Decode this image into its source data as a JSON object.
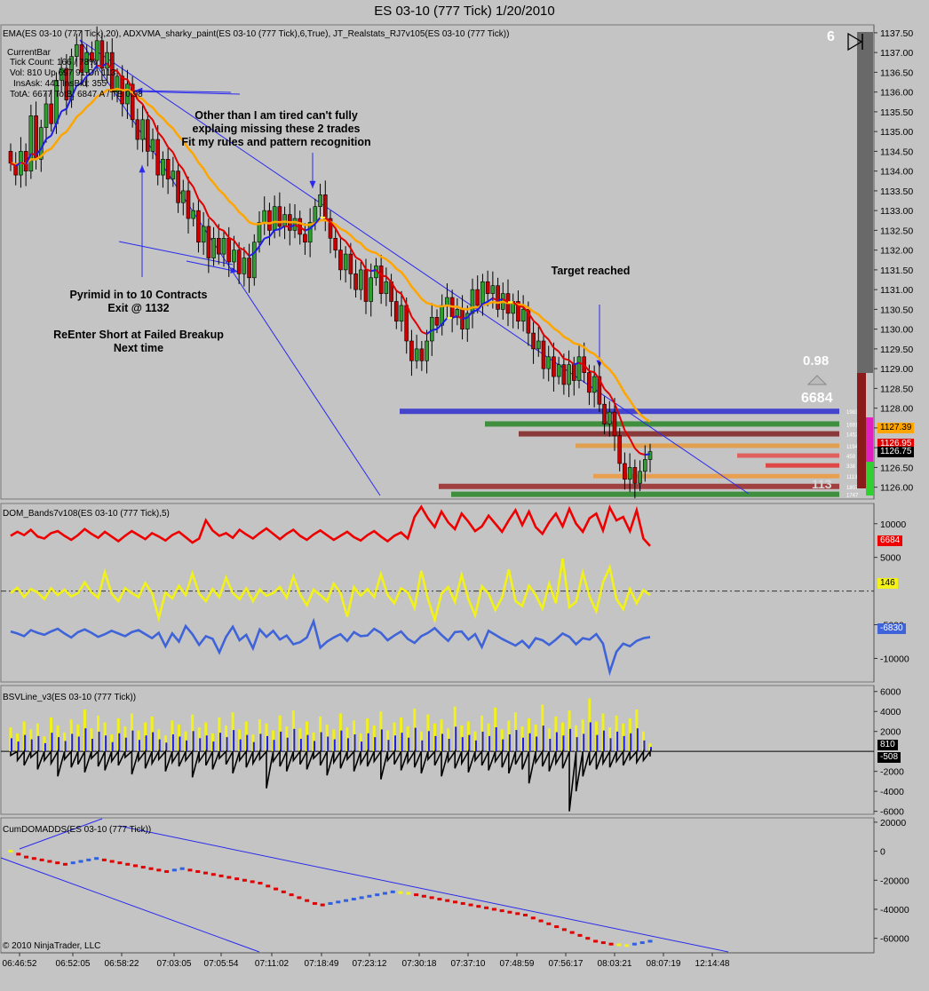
{
  "window_title": "ES 03-10 (777 Tick)  1/20/2010",
  "copyright": "© 2010 NinjaTrader, LLC",
  "panels": {
    "price_label": "EMA(ES 03-10 (777 Tick),20), ADXVMA_sharky_paint(ES 03-10 (777 Tick),6,True), JT_Realstats_RJ7v105(ES 03-10 (777 Tick))",
    "dom_label": "DOM_Bands7v108(ES 03-10 (777 Tick),5)",
    "bsv_label": "BSVLine_v3(ES 03-10 (777 Tick))",
    "cum_label": "CumDOMADDS(ES 03-10 (777 Tick))"
  },
  "current_bar": {
    "title": "CurrentBar",
    "line1": "Tick Count: 166  /  78%",
    "line2": "Vol: 810   Up 697  91   Dn 113",
    "line3": "InsAsk: 441   InsBid: 355",
    "line4": "TotA: 6677  TotB: 6847  A / TB 0.98"
  },
  "annotations": {
    "tired_1": "Other than I am tired can't fully",
    "tired_2": "explaing missing these 2 trades",
    "tired_3": "Fit my rules and pattern recognition",
    "pyramid_1": "Pyrimid in to 10 Contracts",
    "pyramid_2": "Exit @ 1132",
    "reenter_1": "ReEnter Short at Failed Breakup",
    "reenter_2": "Next time",
    "target": "Target reached"
  },
  "stats": {
    "count": "6",
    "ratio": "0.98",
    "total": "6684",
    "small": "113"
  },
  "tags": {
    "price_a": "1127.39",
    "price_b": "1126.95",
    "price_c": "1126.75",
    "dom_red": "6684",
    "dom_yellow": "146",
    "dom_blue": "-6830",
    "bsv_a": "810",
    "bsv_b": "-508"
  },
  "level_labels": [
    "1983",
    "1691",
    "1452",
    "1194",
    "459",
    "338",
    "1113",
    "1807",
    "1747"
  ],
  "colors": {
    "bg": "#c4c4c4",
    "up": "#2e9e2e",
    "down": "#c80000",
    "ema": "#ffa500",
    "adx_red": "#e00000",
    "adx_blue": "#1e1ee6",
    "adx_yellow": "#ffff33",
    "trend": "#2a2aee",
    "dom_red": "#ee0000",
    "dom_yellow": "#f2f21a",
    "dom_blue": "#3f63d8"
  },
  "chart_data": [
    {
      "type": "candlestick",
      "name": "price",
      "ylim": [
        1125.7,
        1137.7
      ],
      "y_ticks": [
        "1137.50",
        "1137.00",
        "1136.50",
        "1136.00",
        "1135.50",
        "1135.00",
        "1134.50",
        "1134.00",
        "1133.50",
        "1133.00",
        "1132.50",
        "1132.00",
        "1131.50",
        "1131.00",
        "1130.50",
        "1130.00",
        "1129.50",
        "1129.00",
        "1128.50",
        "1128.00",
        "1127.50",
        "1127.00",
        "1126.50",
        "1126.00"
      ],
      "closes": [
        1134.2,
        1133.9,
        1134.5,
        1134.0,
        1135.4,
        1134.3,
        1135.1,
        1135.7,
        1135.2,
        1136.3,
        1136.6,
        1135.8,
        1136.9,
        1137.2,
        1136.5,
        1137.0,
        1136.8,
        1137.3,
        1136.6,
        1137.0,
        1136.0,
        1136.4,
        1135.7,
        1136.2,
        1135.3,
        1134.8,
        1135.3,
        1134.5,
        1134.8,
        1133.9,
        1134.3,
        1133.8,
        1134.0,
        1133.2,
        1133.5,
        1132.8,
        1133.0,
        1132.2,
        1132.6,
        1131.8,
        1132.3,
        1131.9,
        1132.3,
        1131.7,
        1132.0,
        1131.4,
        1131.8,
        1131.3,
        1132.2,
        1132.7,
        1133.0,
        1132.5,
        1133.1,
        1132.6,
        1132.9,
        1132.5,
        1132.8,
        1132.4,
        1132.2,
        1132.7,
        1133.1,
        1133.4,
        1132.8,
        1132.3,
        1132.0,
        1131.5,
        1131.9,
        1131.4,
        1131.0,
        1131.5,
        1130.7,
        1131.3,
        1131.6,
        1130.9,
        1131.2,
        1130.7,
        1130.2,
        1130.6,
        1129.7,
        1129.2,
        1129.5,
        1129.2,
        1129.7,
        1130.3,
        1130.1,
        1130.6,
        1130.8,
        1130.3,
        1130.5,
        1130.0,
        1130.4,
        1131.0,
        1130.6,
        1131.2,
        1130.9,
        1131.1,
        1130.5,
        1130.9,
        1130.4,
        1130.7,
        1130.2,
        1130.5,
        1129.9,
        1129.5,
        1129.7,
        1129.0,
        1129.3,
        1128.8,
        1129.1,
        1128.6,
        1129.1,
        1128.7,
        1129.3,
        1128.9,
        1128.4,
        1128.8,
        1128.1,
        1127.6,
        1127.9,
        1127.3,
        1126.6,
        1126.2,
        1126.5,
        1126.1,
        1126.4,
        1126.7,
        1126.9
      ]
    },
    {
      "type": "line",
      "name": "DOM_Bands",
      "ylim": [
        -13500,
        13000
      ],
      "y_ticks": [
        "10000",
        "5000",
        "-5000",
        "-10000"
      ],
      "series": [
        {
          "name": "red",
          "values": [
            8200,
            8800,
            8300,
            9100,
            8100,
            7800,
            8600,
            8900,
            8200,
            7600,
            8300,
            9200,
            8500,
            7900,
            8800,
            8100,
            7400,
            8200,
            8900,
            8300,
            7700,
            8600,
            8100,
            7500,
            8300,
            8800,
            8000,
            7200,
            7800,
            10500,
            9000,
            8200,
            8600,
            7900,
            9100,
            8400,
            7800,
            8600,
            9300,
            8500,
            7700,
            8500,
            9100,
            8200,
            7600,
            8400,
            9000,
            8300,
            7600,
            8200,
            8800,
            8000,
            7500,
            8300,
            8900,
            8100,
            7400,
            8200,
            8700,
            7800,
            11000,
            12500,
            10800,
            9500,
            11800,
            10200,
            9200,
            11500,
            10300,
            8900,
            9600,
            11200,
            10000,
            8800,
            10500,
            12000,
            9800,
            11800,
            9500,
            8500,
            10200,
            11500,
            9600,
            12200,
            10000,
            8800,
            10800,
            11500,
            9000,
            12400,
            10500,
            11000,
            8900,
            12000,
            7800,
            6684
          ]
        },
        {
          "name": "yellow",
          "values": [
            -300,
            500,
            -900,
            300,
            -200,
            -1200,
            400,
            -600,
            200,
            -800,
            -300,
            1300,
            -200,
            -1000,
            2800,
            -400,
            -1500,
            400,
            -300,
            -900,
            1200,
            -300,
            -4000,
            -200,
            -1100,
            800,
            -600,
            2600,
            -400,
            -1500,
            300,
            -900,
            2000,
            -300,
            -1200,
            400,
            -1500,
            200,
            -700,
            -300,
            600,
            -1000,
            2100,
            -500,
            -2100,
            200,
            -600,
            -1500,
            1100,
            -300,
            -3800,
            600,
            -700,
            300,
            -900,
            2500,
            -600,
            -1800,
            400,
            -200,
            -2500,
            3000,
            -1200,
            -4300,
            -400,
            600,
            -1600,
            2400,
            -1200,
            -3600,
            700,
            -400,
            -2800,
            -1000,
            3200,
            -1500,
            -2200,
            800,
            -600,
            -2600,
            1100,
            -1800,
            4800,
            -2400,
            -1600,
            2700,
            -800,
            -3000,
            1300,
            3500,
            -1200,
            -2700,
            300,
            -1800,
            146,
            -600
          ]
        },
        {
          "name": "blue",
          "values": [
            -6000,
            -6300,
            -6700,
            -5800,
            -6200,
            -6500,
            -6000,
            -5600,
            -6300,
            -6900,
            -6100,
            -5700,
            -6200,
            -6800,
            -6400,
            -5900,
            -6300,
            -6700,
            -6100,
            -5800,
            -6400,
            -7000,
            -6200,
            -8200,
            -6300,
            -7500,
            -5200,
            -6400,
            -8000,
            -6700,
            -7100,
            -9100,
            -6800,
            -5300,
            -7300,
            -6500,
            -8500,
            -5700,
            -6800,
            -5900,
            -7200,
            -6600,
            -7900,
            -7600,
            -6900,
            -4500,
            -8400,
            -7500,
            -6900,
            -6400,
            -7400,
            -6100,
            -6700,
            -6600,
            -5600,
            -6200,
            -7300,
            -6600,
            -6000,
            -7100,
            -7700,
            -6700,
            -6200,
            -5500,
            -6500,
            -7400,
            -6100,
            -6000,
            -7200,
            -6400,
            -8300,
            -5900,
            -6500,
            -7100,
            -7600,
            -8100,
            -7400,
            -8400,
            -7000,
            -7300,
            -8000,
            -7200,
            -6300,
            -6800,
            -7900,
            -7000,
            -7200,
            -6400,
            -7800,
            -12000,
            -9000,
            -7800,
            -8200,
            -7400,
            -7000,
            -6830
          ]
        }
      ]
    },
    {
      "type": "bar",
      "name": "BSVLine",
      "ylim": [
        -6300,
        6600
      ],
      "y_ticks": [
        "6000",
        "4000",
        "2000",
        "-2000",
        "-4000",
        "-6000"
      ],
      "series": [
        {
          "name": "buy",
          "values": [
            2400,
            1800,
            3000,
            2200,
            2800,
            1500,
            3400,
            2600,
            1900,
            3200,
            2700,
            4200,
            2300,
            3600,
            2900,
            1700,
            3300,
            2500,
            3800,
            2100,
            2900,
            3500,
            2200,
            1600,
            3100,
            2700,
            2000,
            3700,
            2400,
            2900,
            1800,
            3400,
            2600,
            3900,
            2200,
            3000,
            1700,
            3200,
            2800,
            2100,
            3600,
            2500,
            4100,
            2300,
            3000,
            1900,
            3500,
            2700,
            2200,
            3800,
            2400,
            3100,
            1800,
            3300,
            2600,
            4000,
            2100,
            2900,
            3400,
            2500,
            4300,
            2000,
            3700,
            2800,
            3200,
            2300,
            4500,
            2600,
            3000,
            2000,
            3600,
            2800,
            4400,
            2200,
            3100,
            3900,
            2500,
            3300,
            2700,
            4700,
            2300,
            3500,
            2900,
            4100,
            2600,
            3200,
            5300,
            3000,
            3800,
            2400,
            3600,
            2800,
            3300,
            4200,
            2000,
            810
          ]
        },
        {
          "name": "sell",
          "values": [
            -400,
            -900,
            -1400,
            -600,
            -1800,
            -900,
            -1200,
            -2500,
            -800,
            -1600,
            -1300,
            -2100,
            -700,
            -1500,
            -1900,
            -1000,
            -1400,
            -600,
            -2300,
            -900,
            -1700,
            -1200,
            -800,
            -2000,
            -1100,
            -1500,
            -900,
            -2600,
            -1000,
            -1400,
            -1800,
            -700,
            -1300,
            -2200,
            -900,
            -1600,
            -1200,
            -800,
            -3700,
            -1000,
            -1500,
            -2000,
            -900,
            -1300,
            -1800,
            -700,
            -1400,
            -2400,
            -1100,
            -1700,
            -800,
            -2000,
            -1200,
            -1500,
            -1000,
            -2800,
            -900,
            -1300,
            -1900,
            -1100,
            -1600,
            -2200,
            -800,
            -1400,
            -2500,
            -1000,
            -1700,
            -1200,
            -2100,
            -900,
            -1400,
            -1900,
            -1000,
            -1600,
            -2200,
            -1300,
            -1800,
            -3200,
            -1100,
            -1500,
            -2000,
            -1200,
            -1700,
            -6000,
            -4000,
            -2500,
            -1400,
            -1800,
            -1200,
            -1600,
            -1000,
            -1400,
            -800,
            -1100,
            -900,
            -508
          ]
        }
      ]
    },
    {
      "type": "line",
      "name": "CumDOMADDS",
      "ylim": [
        -70000,
        23000
      ],
      "y_ticks": [
        "20000",
        "0",
        "-20000",
        "-40000",
        "-60000"
      ],
      "values": [
        0,
        -2000,
        -4000,
        -5000,
        -6000,
        -7000,
        -8000,
        -9000,
        -8000,
        -7000,
        -6000,
        -5000,
        -6000,
        -7000,
        -8000,
        -9000,
        -10000,
        -11000,
        -12000,
        -13000,
        -14000,
        -13000,
        -12000,
        -13000,
        -14000,
        -15000,
        -16000,
        -17000,
        -18000,
        -19000,
        -20000,
        -21000,
        -22000,
        -24000,
        -26000,
        -28000,
        -30000,
        -32000,
        -34000,
        -36000,
        -37000,
        -36000,
        -35000,
        -34000,
        -33000,
        -32000,
        -31000,
        -30000,
        -29000,
        -28000,
        -28500,
        -29000,
        -30000,
        -31000,
        -32000,
        -33000,
        -34000,
        -35000,
        -36000,
        -37000,
        -38000,
        -39000,
        -40000,
        -41000,
        -42000,
        -43000,
        -44000,
        -46000,
        -48000,
        -50000,
        -52000,
        -54000,
        -56000,
        -58000,
        -60000,
        -62000,
        -63000,
        -64000,
        -64500,
        -65000,
        -64000,
        -63000,
        -62000
      ],
      "x_ticks": [
        "06:46:52",
        "06:52:05",
        "06:58:22",
        "07:03:05",
        "07:05:54",
        "07:11:02",
        "07:18:49",
        "07:23:12",
        "07:30:18",
        "07:37:10",
        "07:48:59",
        "07:56:17",
        "08:03:21",
        "08:07:19",
        "12:14:48"
      ]
    }
  ]
}
